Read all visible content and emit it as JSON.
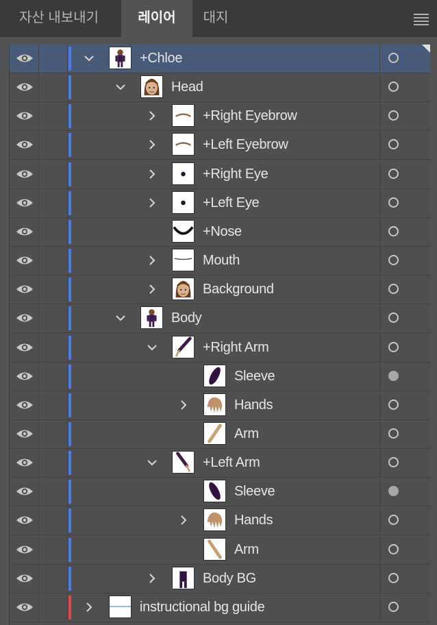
{
  "tabs": [
    {
      "label": "자산 내보내기"
    },
    {
      "label": "레이어"
    },
    {
      "label": "대지"
    }
  ],
  "colors": {
    "layer_blue": "#4a7af0",
    "layer_red": "#e8454b",
    "selected_row": "#475b78"
  },
  "layers": [
    {
      "name": "+Chloe",
      "depth": 0,
      "expander": "expanded",
      "thumb": "figure",
      "selected": true,
      "target_filled": false,
      "color": "blue"
    },
    {
      "name": "Head",
      "depth": 1,
      "expander": "expanded",
      "thumb": "head",
      "selected": false,
      "target_filled": false,
      "color": "blue"
    },
    {
      "name": "+Right Eyebrow",
      "depth": 2,
      "expander": "collapsed",
      "thumb": "brow",
      "selected": false,
      "target_filled": false,
      "color": "blue"
    },
    {
      "name": "+Left Eyebrow",
      "depth": 2,
      "expander": "collapsed",
      "thumb": "brow",
      "selected": false,
      "target_filled": false,
      "color": "blue"
    },
    {
      "name": "+Right Eye",
      "depth": 2,
      "expander": "collapsed",
      "thumb": "eye",
      "selected": false,
      "target_filled": false,
      "color": "blue"
    },
    {
      "name": "+Left Eye",
      "depth": 2,
      "expander": "collapsed",
      "thumb": "eye",
      "selected": false,
      "target_filled": false,
      "color": "blue"
    },
    {
      "name": "+Nose",
      "depth": 2,
      "expander": "none",
      "thumb": "nose",
      "selected": false,
      "target_filled": false,
      "color": "blue"
    },
    {
      "name": "Mouth",
      "depth": 2,
      "expander": "collapsed",
      "thumb": "mouth",
      "selected": false,
      "target_filled": false,
      "color": "blue"
    },
    {
      "name": "Background",
      "depth": 2,
      "expander": "collapsed",
      "thumb": "head",
      "selected": false,
      "target_filled": false,
      "color": "blue"
    },
    {
      "name": "Body",
      "depth": 1,
      "expander": "expanded",
      "thumb": "figure",
      "selected": false,
      "target_filled": false,
      "color": "blue"
    },
    {
      "name": "+Right Arm",
      "depth": 2,
      "expander": "expanded",
      "thumb": "arm",
      "selected": false,
      "target_filled": false,
      "color": "blue"
    },
    {
      "name": "Sleeve",
      "depth": 3,
      "expander": "none",
      "thumb": "sleeve",
      "selected": false,
      "target_filled": true,
      "color": "blue"
    },
    {
      "name": "Hands",
      "depth": 3,
      "expander": "collapsed",
      "thumb": "hand",
      "selected": false,
      "target_filled": false,
      "color": "blue"
    },
    {
      "name": "Arm",
      "depth": 3,
      "expander": "none",
      "thumb": "skinarm",
      "selected": false,
      "target_filled": false,
      "color": "blue"
    },
    {
      "name": "+Left Arm",
      "depth": 2,
      "expander": "expanded",
      "thumb": "arm2",
      "selected": false,
      "target_filled": false,
      "color": "blue"
    },
    {
      "name": "Sleeve",
      "depth": 3,
      "expander": "none",
      "thumb": "sleeve2",
      "selected": false,
      "target_filled": true,
      "color": "blue"
    },
    {
      "name": "Hands",
      "depth": 3,
      "expander": "collapsed",
      "thumb": "hand",
      "selected": false,
      "target_filled": false,
      "color": "blue"
    },
    {
      "name": "Arm",
      "depth": 3,
      "expander": "none",
      "thumb": "skinarm2",
      "selected": false,
      "target_filled": false,
      "color": "blue"
    },
    {
      "name": "Body BG",
      "depth": 2,
      "expander": "collapsed",
      "thumb": "bodybg",
      "selected": false,
      "target_filled": false,
      "color": "blue"
    },
    {
      "name": "instructional bg guide",
      "depth": 0,
      "expander": "collapsed",
      "thumb": "guide",
      "selected": false,
      "target_filled": false,
      "color": "red"
    }
  ]
}
